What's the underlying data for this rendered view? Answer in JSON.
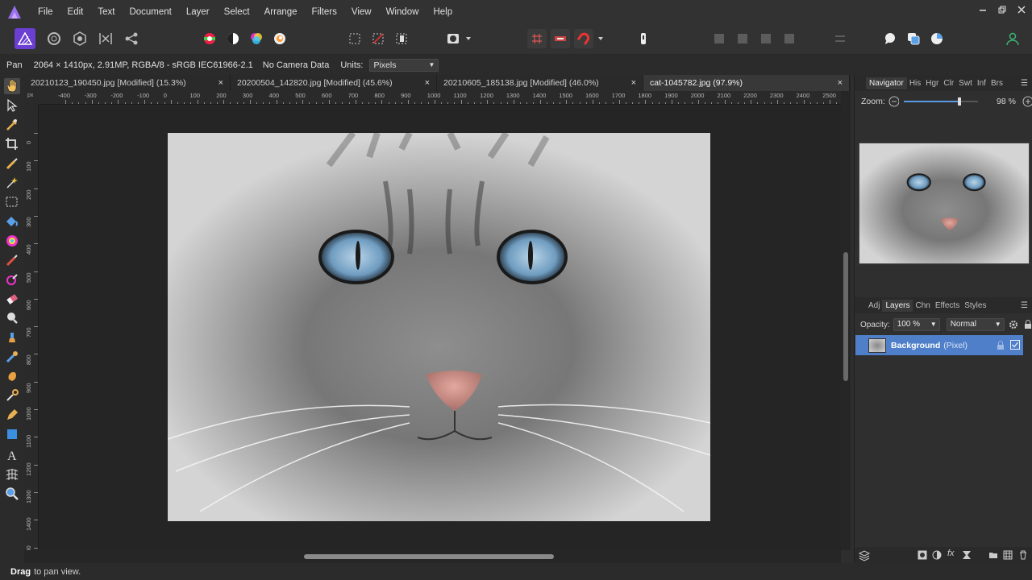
{
  "menubar": {
    "items": [
      "File",
      "Edit",
      "Text",
      "Document",
      "Layer",
      "Select",
      "Arrange",
      "Filters",
      "View",
      "Window",
      "Help"
    ]
  },
  "context": {
    "tool_name": "Pan",
    "image_info": "2064 × 1410px, 2.91MP, RGBA/8 - sRGB IEC61966-2.1",
    "camera": "No Camera Data",
    "units_label": "Units:",
    "units_value": "Pixels"
  },
  "tabs": [
    {
      "title": "20210123_190450.jpg [Modified] (15.3%)",
      "close": "×"
    },
    {
      "title": "20200504_142820.jpg [Modified] (45.6%)",
      "close": "×"
    },
    {
      "title": "20210605_185138.jpg [Modified] (46.0%)",
      "close": "×"
    },
    {
      "title": "cat-1045782.jpg (97.9%)",
      "close": "×"
    }
  ],
  "ruler": {
    "unit": "px",
    "h_labels": [
      "-400",
      "-300",
      "-200",
      "-100",
      "0",
      "100",
      "200",
      "300",
      "400",
      "500",
      "600",
      "700",
      "800",
      "900",
      "1000",
      "1100",
      "1200",
      "1300",
      "1400",
      "1500",
      "1600",
      "1700",
      "1800",
      "1900",
      "2000",
      "2100",
      "2200",
      "2300",
      "2400",
      "2500"
    ],
    "v_labels": [
      "0",
      "100",
      "200",
      "300",
      "400",
      "500",
      "600",
      "700",
      "800",
      "900",
      "1000",
      "1100",
      "1200",
      "1300",
      "1400",
      "1500"
    ]
  },
  "navigator": {
    "tabs": [
      "Navigator",
      "His",
      "Hgr",
      "Clr",
      "Swt",
      "Inf",
      "Brs"
    ],
    "zoom_label": "Zoom:",
    "zoom_value": "98 %",
    "zoom_fraction": 0.75
  },
  "layers": {
    "tabs": [
      "Adj",
      "Layers",
      "Chn",
      "Effects",
      "Styles"
    ],
    "opacity_label": "Opacity:",
    "opacity_value": "100 %",
    "blend_mode": "Normal",
    "items": [
      {
        "name": "Background",
        "type": "(Pixel)",
        "visible": true
      }
    ]
  },
  "status": {
    "bold": "Drag",
    "text": "to pan view."
  },
  "colors": {
    "accent": "#4f7fc8",
    "brand": "#7b4fd0",
    "persona_active": "#6a3fd1"
  }
}
